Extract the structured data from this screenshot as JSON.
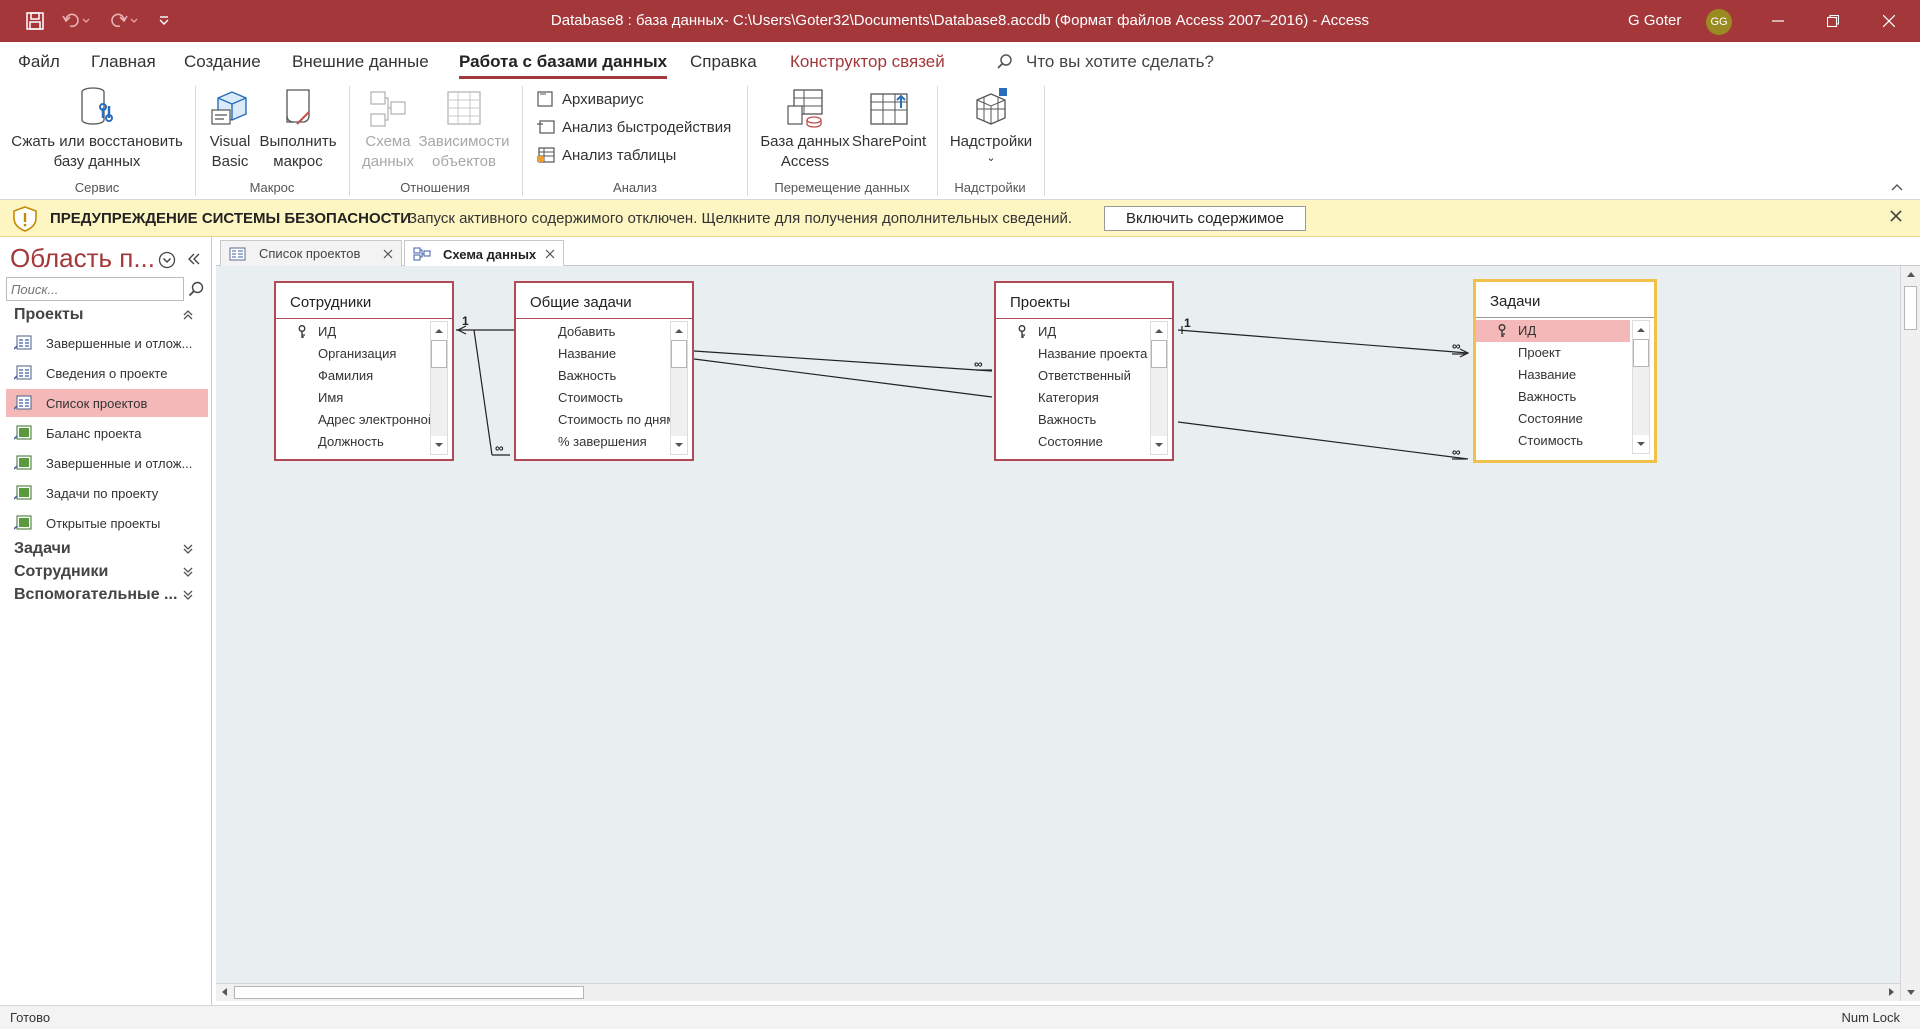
{
  "window": {
    "title": "Database8 : база данных- C:\\Users\\Goter32\\Documents\\Database8.accdb (Формат файлов Access 2007–2016)  -  Access",
    "user": "G Goter",
    "avatar_initials": "GG",
    "accent_color": "#a4373a"
  },
  "ribbon_tabs": [
    {
      "label": "Файл"
    },
    {
      "label": "Главная"
    },
    {
      "label": "Создание"
    },
    {
      "label": "Внешние данные"
    },
    {
      "label": "Работа с базами данных",
      "active": true
    },
    {
      "label": "Справка"
    },
    {
      "label": "Конструктор связей",
      "contextual": true
    }
  ],
  "tell_me": "Что вы хотите сделать?",
  "ribbon": {
    "compact": {
      "line1": "Сжать или восстановить",
      "line2": "базу данных"
    },
    "visual_basic": {
      "line1": "Visual",
      "line2": "Basic"
    },
    "run_macro": {
      "line1": "Выполнить",
      "line2": "макрос"
    },
    "schema": {
      "line1": "Схема",
      "line2": "данных"
    },
    "dependencies": {
      "line1": "Зависимости",
      "line2": "объектов"
    },
    "documenter": "Архивариус",
    "perf_analyzer": "Анализ быстродействия",
    "table_analyzer": "Анализ таблицы",
    "access_db": {
      "line1": "База данных",
      "line2": "Access"
    },
    "sharepoint": "SharePoint",
    "addins": "Надстройки",
    "groups": {
      "service": "Сервис",
      "macro": "Макрос",
      "relations": "Отношения",
      "analysis": "Анализ",
      "move_data": "Перемещение данных",
      "addins": "Надстройки"
    }
  },
  "security": {
    "title": "ПРЕДУПРЕЖДЕНИЕ СИСТЕМЫ БЕЗОПАСНОСТИ",
    "message": "Запуск активного содержимого отключен. Щелкните для получения дополнительных сведений.",
    "button": "Включить содержимое"
  },
  "nav": {
    "title": "Область п...",
    "search_placeholder": "Поиск...",
    "groups": [
      {
        "label": "Проекты",
        "expanded": true
      },
      {
        "label": "Задачи"
      },
      {
        "label": "Сотрудники"
      },
      {
        "label": "Вспомогательные ..."
      }
    ],
    "items": [
      {
        "label": "Завершенные и отлож...",
        "type": "form"
      },
      {
        "label": "Сведения о проекте",
        "type": "form"
      },
      {
        "label": "Список проектов",
        "type": "form",
        "selected": true
      },
      {
        "label": "Баланс проекта",
        "type": "report"
      },
      {
        "label": "Завершенные и отлож...",
        "type": "report"
      },
      {
        "label": "Задачи по проекту",
        "type": "report"
      },
      {
        "label": "Открытые проекты",
        "type": "report"
      }
    ]
  },
  "doc_tabs": [
    {
      "label": "Список проектов"
    },
    {
      "label": "Схема данных",
      "active": true
    }
  ],
  "tables": [
    {
      "name": "Сотрудники",
      "fields": [
        "ИД",
        "Организация",
        "Фамилия",
        "Имя",
        "Адрес электронной",
        "Должность"
      ]
    },
    {
      "name": "Общие задачи",
      "fields": [
        "Добавить",
        "Название",
        "Важность",
        "Стоимость",
        "Стоимость по дням",
        "% завершения"
      ]
    },
    {
      "name": "Проекты",
      "fields": [
        "ИД",
        "Название проекта",
        "Ответственный",
        "Категория",
        "Важность",
        "Состояние"
      ]
    },
    {
      "name": "Задачи",
      "fields": [
        "ИД",
        "Проект",
        "Название",
        "Важность",
        "Состояние",
        "Стоимость"
      ],
      "selected": true
    }
  ],
  "relationship_labels": {
    "one": "1",
    "many": "∞"
  },
  "status": {
    "left": "Готово",
    "right": "Num Lock"
  }
}
